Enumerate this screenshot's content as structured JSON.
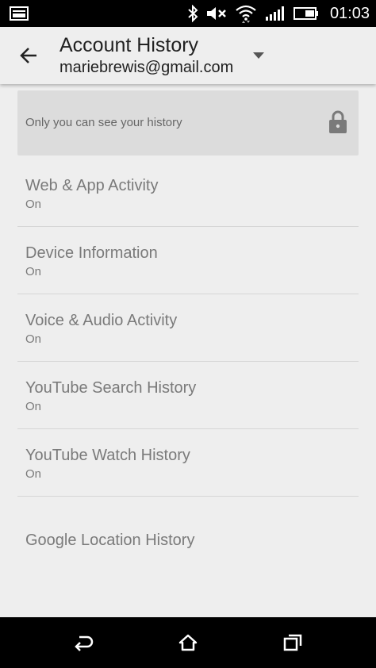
{
  "status_bar": {
    "time": "01:03",
    "icons": [
      "screenshot-icon",
      "bluetooth-icon",
      "mute-icon",
      "wifi-icon",
      "signal-icon",
      "battery-icon"
    ]
  },
  "app_bar": {
    "title": "Account History",
    "account": "mariebrewis@gmail.com",
    "icons": [
      "back-arrow-icon",
      "dropdown-arrow-icon"
    ]
  },
  "privacy_banner": {
    "text": "Only you can see your history",
    "icon": "lock-icon"
  },
  "history": {
    "items": [
      {
        "title": "Web & App Activity",
        "status": "On"
      },
      {
        "title": "Device Information",
        "status": "On"
      },
      {
        "title": "Voice & Audio Activity",
        "status": "On"
      },
      {
        "title": "YouTube Search History",
        "status": "On"
      },
      {
        "title": "YouTube Watch History",
        "status": "On"
      },
      {
        "title": "Google Location History"
      }
    ]
  },
  "nav_bar": {
    "icons": [
      "back-icon",
      "home-icon",
      "recent-apps-icon"
    ]
  },
  "colors": {
    "background": "#eeeeee",
    "banner": "#dcdcdc",
    "list_text": "#7a7a7a",
    "title_text": "#212121"
  }
}
